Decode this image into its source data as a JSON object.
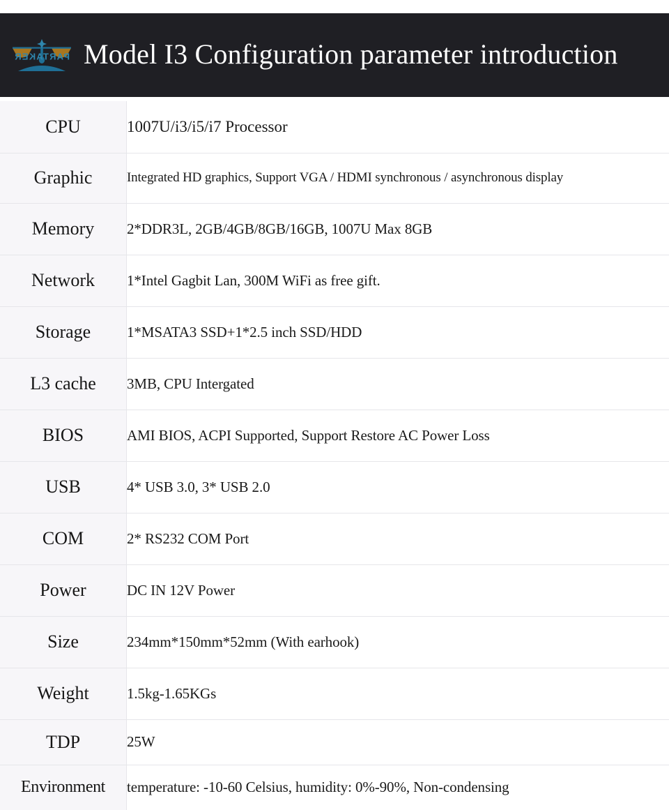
{
  "header": {
    "title": "Model I3 Configuration parameter introduction",
    "logo_text": "PARTAKER",
    "logo_icon": "balance-scale-icon",
    "background_color": "#1f1f24",
    "title_color": "#fdfdfd",
    "logo_gold": "#a9761f",
    "logo_blue": "#1f6f96"
  },
  "table": {
    "label_column_background": "#f7f6f9",
    "divider_color": "#e6e6ea",
    "rows": [
      {
        "label": "CPU",
        "value": "1007U/i3/i5/i7 Processor"
      },
      {
        "label": "Graphic",
        "value": "Integrated HD graphics, Support VGA / HDMI synchronous / asynchronous display"
      },
      {
        "label": "Memory",
        "value": "2*DDR3L, 2GB/4GB/8GB/16GB, 1007U Max 8GB"
      },
      {
        "label": "Network",
        "value": "1*Intel Gagbit Lan, 300M WiFi as free gift."
      },
      {
        "label": "Storage",
        "value": "1*MSATA3 SSD+1*2.5 inch SSD/HDD"
      },
      {
        "label": "L3 cache",
        "value": "3MB, CPU Intergated"
      },
      {
        "label": "BIOS",
        "value": "AMI BIOS, ACPI Supported, Support Restore AC Power Loss"
      },
      {
        "label": "USB",
        "value": "4* USB 3.0, 3* USB 2.0"
      },
      {
        "label": "COM",
        "value": "2* RS232  COM  Port"
      },
      {
        "label": "Power",
        "value": "DC IN 12V Power"
      },
      {
        "label": "Size",
        "value": "234mm*150mm*52mm (With earhook)"
      },
      {
        "label": "Weight",
        "value": "1.5kg-1.65KGs"
      },
      {
        "label": "TDP",
        "value": "25W"
      },
      {
        "label": "Environment",
        "value": "temperature: -10-60 Celsius, humidity: 0%-90%, Non-condensing"
      }
    ]
  }
}
